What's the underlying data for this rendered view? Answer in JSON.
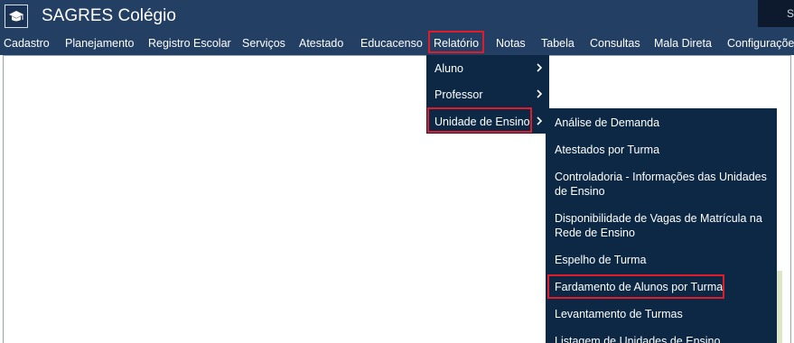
{
  "app": {
    "title": "SAGRES Colégio",
    "corner_text": "S"
  },
  "colors": {
    "bar": "#233f63",
    "dropdown": "#0c2844",
    "highlight": "#e01b2a"
  },
  "menubar": {
    "items": [
      "Cadastro",
      "Planejamento",
      "Registro Escolar",
      "Serviços",
      "Atestado",
      "Educacenso",
      "Relatório",
      "Notas",
      "Tabela",
      "Consultas",
      "Mala Direta",
      "Configurações"
    ]
  },
  "dropdown": {
    "items": [
      "Aluno",
      "Professor",
      "Unidade de Ensino"
    ]
  },
  "submenu": {
    "items": [
      "Análise de Demanda",
      "Atestados por Turma",
      "Controladoria - Informações das Unidades de Ensino",
      "Disponibilidade de Vagas de Matrícula na Rede de Ensino",
      "Espelho de Turma",
      "Fardamento de Alunos por Turma",
      "Levantamento de Turmas",
      "Listagem de Unidades de Ensino"
    ]
  },
  "icons": {
    "logo": "graduation-cap-icon",
    "chevron": "chevron-right-icon"
  }
}
